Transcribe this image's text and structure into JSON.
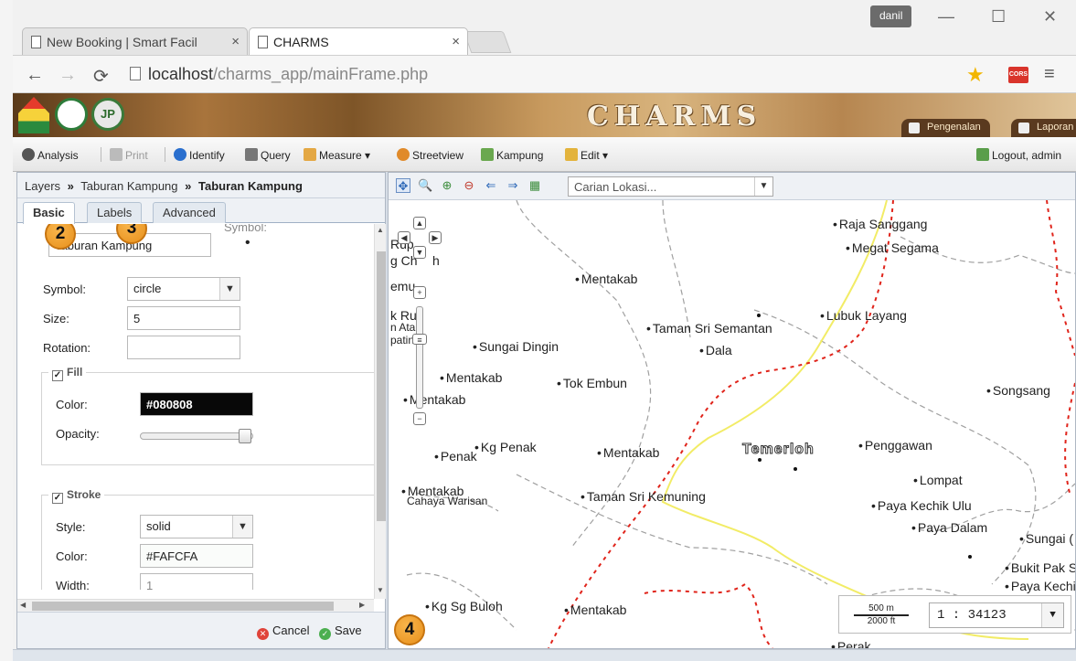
{
  "browser": {
    "tabs": [
      {
        "title": "New Booking | Smart Facil",
        "active": false
      },
      {
        "title": "CHARMS",
        "active": true
      }
    ],
    "user": "danil",
    "url_host": "localhost",
    "url_path": "/charms_app/mainFrame.php",
    "cors_label": "CORS"
  },
  "banner": {
    "title": "CHARMS",
    "logo2_text": "JP",
    "buttons": [
      "Pengenalan",
      "Laporan"
    ]
  },
  "menubar": {
    "items": [
      "Analysis",
      "Print",
      "Identify",
      "Query",
      "Measure",
      "Streetview",
      "Kampung",
      "Edit"
    ],
    "logout": "Logout, admin"
  },
  "panel": {
    "breadcrumb": [
      "Layers",
      "Taburan Kampung",
      "Taburan Kampung"
    ],
    "breadcrumb_sep": "»",
    "tabs": [
      "Basic",
      "Labels",
      "Advanced"
    ],
    "form": {
      "name_value": "Taburan Kampung",
      "name_label_partial": "e:",
      "symbol_preview_label": "Symbol:",
      "symbol_label": "Symbol:",
      "symbol_value": "circle",
      "size_label": "Size:",
      "size_value": "5",
      "rotation_label": "Rotation:",
      "rotation_value": "",
      "fill_legend": "Fill",
      "fill_color_label": "Color:",
      "fill_color_value": "#080808",
      "fill_opacity_label": "Opacity:",
      "fill_opacity": 1.0,
      "stroke_legend": "Stroke",
      "stroke_style_label": "Style:",
      "stroke_style_value": "solid",
      "stroke_color_label": "Color:",
      "stroke_color_value": "#FAFCFA",
      "stroke_width_label": "Width:",
      "stroke_width_value": "1"
    },
    "footer": {
      "cancel": "Cancel",
      "save": "Save"
    },
    "callouts": [
      "2",
      "3",
      "4"
    ]
  },
  "map": {
    "search_placeholder": "Carian Lokasi...",
    "town": "Temerloh",
    "places": [
      "Raja Sanggang",
      "Megat Segama",
      "Mentakab",
      "Lubuk Layang",
      "Taman Sri Semantan",
      "Dala",
      "Sungai Dingin",
      "Mentakab",
      "Tok Embun",
      "Mentakab",
      "Songsang",
      "Penggawan",
      "Penak",
      "Kg Penak",
      "Mentakab",
      "Lompat",
      "Mentakab",
      "Cahaya Warisan",
      "Taman Sri Kemuning",
      "Paya Kechik Ulu",
      "Paya Dalam",
      "Sungai (",
      "Bukit Pak Sil",
      "Paya Kechik",
      "Kg Sg Buloh",
      "Mentakab",
      "Perak"
    ],
    "left_fragments": [
      "Rup",
      "g Ch",
      "h",
      "emu",
      "k Rul",
      "n Ata",
      "patin"
    ],
    "scale": {
      "metric": "500 m",
      "imperial": "2000 ft",
      "ratio": "1 : 34123"
    }
  },
  "colors": {
    "road_yellow": "#f2ec66",
    "boundary_red": "#e0241b",
    "boundary_gray": "#9a9a9a",
    "callout": "#f0a030"
  }
}
